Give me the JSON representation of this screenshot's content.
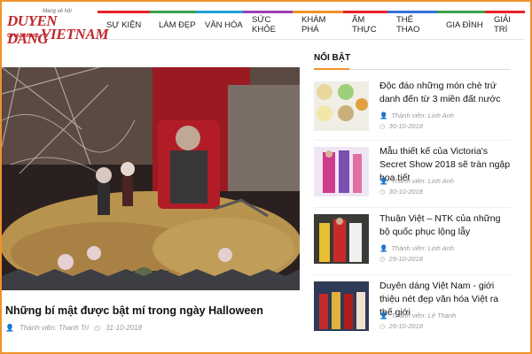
{
  "logo": {
    "tagline": "Mang vẻ hội",
    "line1": "DUYEN DANG",
    "line2a": "CHARMING",
    "line2b": "VIETNAM"
  },
  "nav": [
    {
      "label": "SỰ KIỆN",
      "color": "#e8232a"
    },
    {
      "label": "LÀM ĐẸP",
      "color": "#3aa14a"
    },
    {
      "label": "VĂN HÓA",
      "color": "#22a0d8"
    },
    {
      "label": "SỨC KHỎE",
      "color": "#9c3fb1"
    },
    {
      "label": "KHÁM PHÁ",
      "color": "#f0922b"
    },
    {
      "label": "ẨM THỰC",
      "color": "#e8232a"
    },
    {
      "label": "THỂ THAO",
      "color": "#3a6fd8"
    },
    {
      "label": "GIA ĐÌNH",
      "color": "#3aa14a"
    },
    {
      "label": "GIẢI TRÍ",
      "color": "#e8232a"
    }
  ],
  "feature": {
    "title": "Những bí mật được bật mí trong ngày Halloween",
    "author": "Thành viên: Thanh Trí",
    "date": "31-10-2018"
  },
  "sidebar": {
    "heading": "NỔI BẬT",
    "items": [
      {
        "title": "Độc đáo những món chè trứ danh đến từ 3 miền đất nước",
        "author": "Thành viên: Linh Anh",
        "date": "30-10-2018"
      },
      {
        "title": "Mẫu thiết kế của Victoria's Secret Show 2018 sẽ tràn ngập họa tiết",
        "author": "Thành viên: Linh Anh",
        "date": "30-10-2018"
      },
      {
        "title": "Thuận Việt – NTK của những bộ quốc phục lộng lẫy",
        "author": "Thành viên: Linh Anh",
        "date": "29-10-2018"
      },
      {
        "title": "Duyên dáng Việt Nam - giới thiệu nét đẹp văn hóa Việt ra thế giới",
        "author": "Thành viên: Lê Thanh",
        "date": "29-10-2018"
      }
    ]
  },
  "colors": {
    "accent": "#f0922b",
    "brand": "#c0272d"
  }
}
